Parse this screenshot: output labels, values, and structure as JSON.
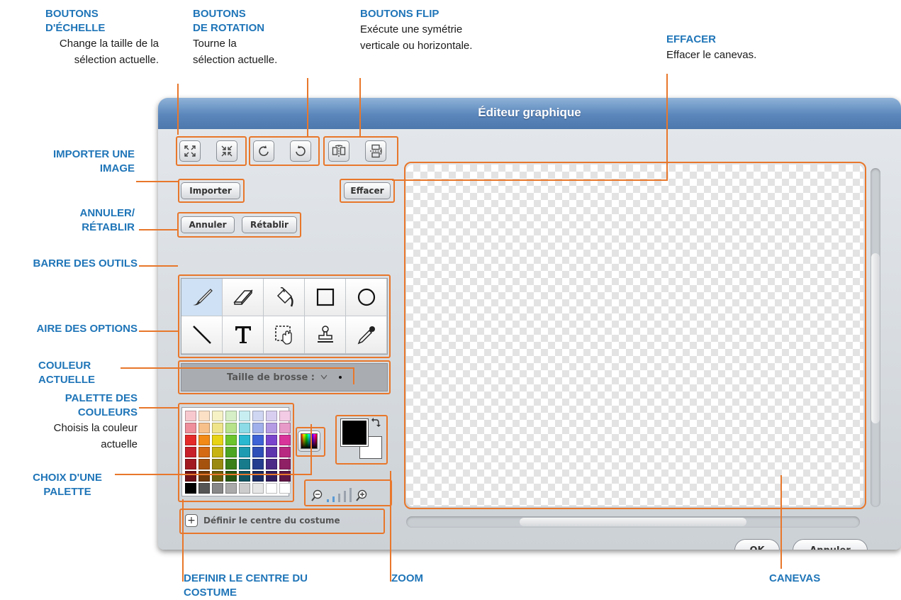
{
  "window": {
    "title": "Éditeur graphique"
  },
  "buttons": {
    "import": "Importer",
    "clear": "Effacer",
    "undo": "Annuler",
    "redo": "Rétablir",
    "ok": "OK",
    "cancel": "Annuler"
  },
  "options": {
    "brush_size_label": "Taille de brosse :"
  },
  "center_costume": {
    "label": "Définir le centre du costume"
  },
  "tools": [
    "paintbrush-icon",
    "eraser-icon",
    "fill-bucket-icon",
    "rectangle-icon",
    "ellipse-icon",
    "line-icon",
    "text-icon",
    "select-icon",
    "stamp-icon",
    "eyedropper-icon"
  ],
  "current_color": {
    "foreground": "#000000",
    "background": "#ffffff"
  },
  "palette": [
    "#f7c9cf",
    "#fbe0c6",
    "#f6f2c6",
    "#d6efc6",
    "#c8eef2",
    "#cfd6f2",
    "#d8cff0",
    "#f3cbe4",
    "#ee8f9b",
    "#f7c08a",
    "#efe48a",
    "#b7e38a",
    "#8cdbe6",
    "#9fb0ea",
    "#b59be4",
    "#e79ac8",
    "#e52a2a",
    "#f28a17",
    "#e8d316",
    "#6cc52c",
    "#2ab8d0",
    "#3d63d6",
    "#7a45cc",
    "#d9349a",
    "#c8202a",
    "#d46a14",
    "#c7b414",
    "#4da622",
    "#1e9bb1",
    "#2f4fb8",
    "#5f35ad",
    "#b82a82",
    "#a11a22",
    "#a6520f",
    "#9a8a10",
    "#3a7f1a",
    "#177b8c",
    "#243d8f",
    "#4a2987",
    "#8f2065",
    "#6e1218",
    "#6e3a0b",
    "#6a5f0b",
    "#275712",
    "#0f5460",
    "#192a63",
    "#331c5e",
    "#611646",
    "#000000",
    "#555555",
    "#888888",
    "#aaaaaa",
    "#cccccc",
    "#e6e6e6",
    "#ffffff",
    "#ffffff"
  ],
  "annotations": {
    "scale_buttons": {
      "title": "BOUTONS\nD'ÉCHELLE",
      "desc": "Change la taille de la\nsélection actuelle."
    },
    "rotation_buttons": {
      "title": "BOUTONS\nDE ROTATION",
      "desc": "Tourne la\nsélection actuelle."
    },
    "flip_buttons": {
      "title": "BOUTONS FLIP",
      "desc": "Exécute une symétrie\nverticale ou horizontale."
    },
    "clear": {
      "title": "EFFACER",
      "desc": "Effacer le canevas."
    },
    "import": {
      "title": "IMPORTER UNE\nIMAGE"
    },
    "undo_redo": {
      "title": "ANNULER/\nRÉTABLIR"
    },
    "toolbar": {
      "title": "BARRE DES OUTILS"
    },
    "options": {
      "title": "AIRE DES OPTIONS"
    },
    "current_color": {
      "title": "COULEUR\nACTUELLE"
    },
    "palette": {
      "title": "PALETTE DES\nCOULEURS",
      "desc": "Choisis la couleur\nactuelle"
    },
    "palette_choice": {
      "title": "CHOIX D'UNE\nPALETTE"
    },
    "define_center": {
      "title": "DEFINIR LE CENTRE DU\nCOSTUME"
    },
    "zoom": {
      "title": "ZOOM"
    },
    "canvas": {
      "title": "CANEVAS"
    }
  }
}
